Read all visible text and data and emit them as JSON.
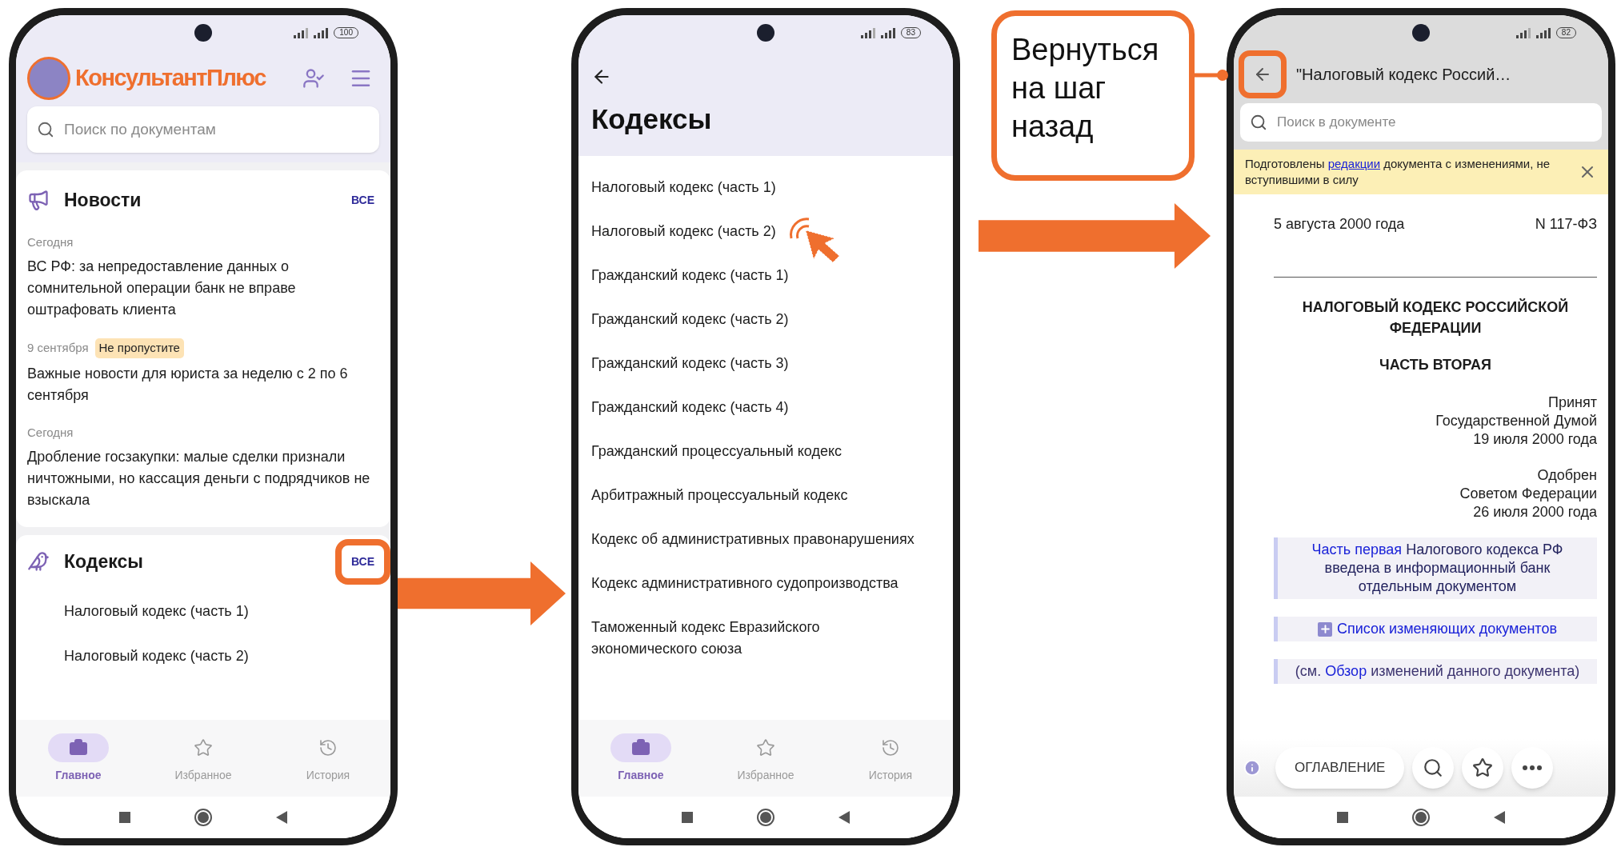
{
  "screen_home": {
    "battery": "100",
    "logo_text": "КонсультантПлюс",
    "search": {
      "placeholder": "Поиск по документам"
    },
    "news": {
      "title": "Новости",
      "all": {
        "label": "ВСЕ",
        "highlighted": false
      },
      "items": [
        {
          "date": "Сегодня",
          "title": "ВС РФ: за непредоставление данных о сомнительной операции банк не вправе оштрафовать клиента"
        },
        {
          "date": "9 сентября",
          "badge": "Не пропустите",
          "title": "Важные новости для юриста за неделю с 2 по 6 сентября"
        },
        {
          "date": "Сегодня",
          "title": "Дробление госзакупки: малые сделки признали ничтожными, но кассация деньги с подрядчиков не взыскала"
        }
      ]
    },
    "codes": {
      "title": "Кодексы",
      "all": {
        "label": "ВСЕ",
        "highlighted": true
      },
      "items": [
        "Налоговый кодекс (часть 1)",
        "Налоговый кодекс (часть 2)"
      ]
    },
    "nav": [
      {
        "label": "Главное",
        "selected": true
      },
      {
        "label": "Избранное",
        "selected": false
      },
      {
        "label": "История",
        "selected": false
      }
    ]
  },
  "screen_codes": {
    "battery": "83",
    "title": "Кодексы",
    "items": [
      {
        "title": "Налоговый кодекс (часть 1)",
        "tapped": false
      },
      {
        "title": "Налоговый кодекс (часть 2)",
        "tapped": true
      },
      {
        "title": "Гражданский кодекс (часть 1)",
        "tapped": false
      },
      {
        "title": "Гражданский кодекс (часть 2)",
        "tapped": false
      },
      {
        "title": "Гражданский кодекс (часть 3)",
        "tapped": false
      },
      {
        "title": "Гражданский кодекс (часть 4)",
        "tapped": false
      },
      {
        "title": "Гражданский процессуальный кодекс",
        "tapped": false
      },
      {
        "title": "Арбитражный процессуальный кодекс",
        "tapped": false
      },
      {
        "title": "Кодекс об административных правонарушениях",
        "tapped": false
      },
      {
        "title": "Кодекс административного судопроизводства",
        "tapped": false
      },
      {
        "title": "Таможенный кодекс Евразийского экономического союза",
        "tapped": false
      }
    ],
    "nav": [
      {
        "label": "Главное",
        "selected": true
      },
      {
        "label": "Избранное",
        "selected": false
      },
      {
        "label": "История",
        "selected": false
      }
    ]
  },
  "callout": {
    "text": "Вернуться на шаг назад"
  },
  "screen_document": {
    "battery": "82",
    "back": {
      "highlighted": true
    },
    "title": "\"Налоговый кодекс Россий…",
    "search": {
      "placeholder": "Поиск в документе"
    },
    "notice": {
      "before": "Подготовлены",
      "link": "редакции",
      "after": "документа с изменениями, не вступившими в силу"
    },
    "date": "5 августа 2000 года",
    "number": "N 117-ФЗ",
    "heading": "НАЛОГОВЫЙ КОДЕКС РОССИЙСКОЙ ФЕДЕРАЦИИ",
    "subheading": "ЧАСТЬ ВТОРАЯ",
    "approvals": [
      [
        "Принят",
        "Государственной Думой",
        "19 июля 2000 года"
      ],
      [
        "Одобрен",
        "Советом Федерации",
        "26 июля 2000 года"
      ]
    ],
    "notes": [
      {
        "kind": "lead_link",
        "link": "Часть первая",
        "after": "Налогового кодекса РФ введена в информационный банк отдельным документом"
      },
      {
        "kind": "expand",
        "link": "Список изменяющих документов"
      },
      {
        "kind": "inline_link",
        "before": "(см.",
        "link": "Обзор",
        "after": "изменений данного документа)"
      }
    ],
    "toc_button": "ОГЛАВЛЕНИЕ"
  }
}
